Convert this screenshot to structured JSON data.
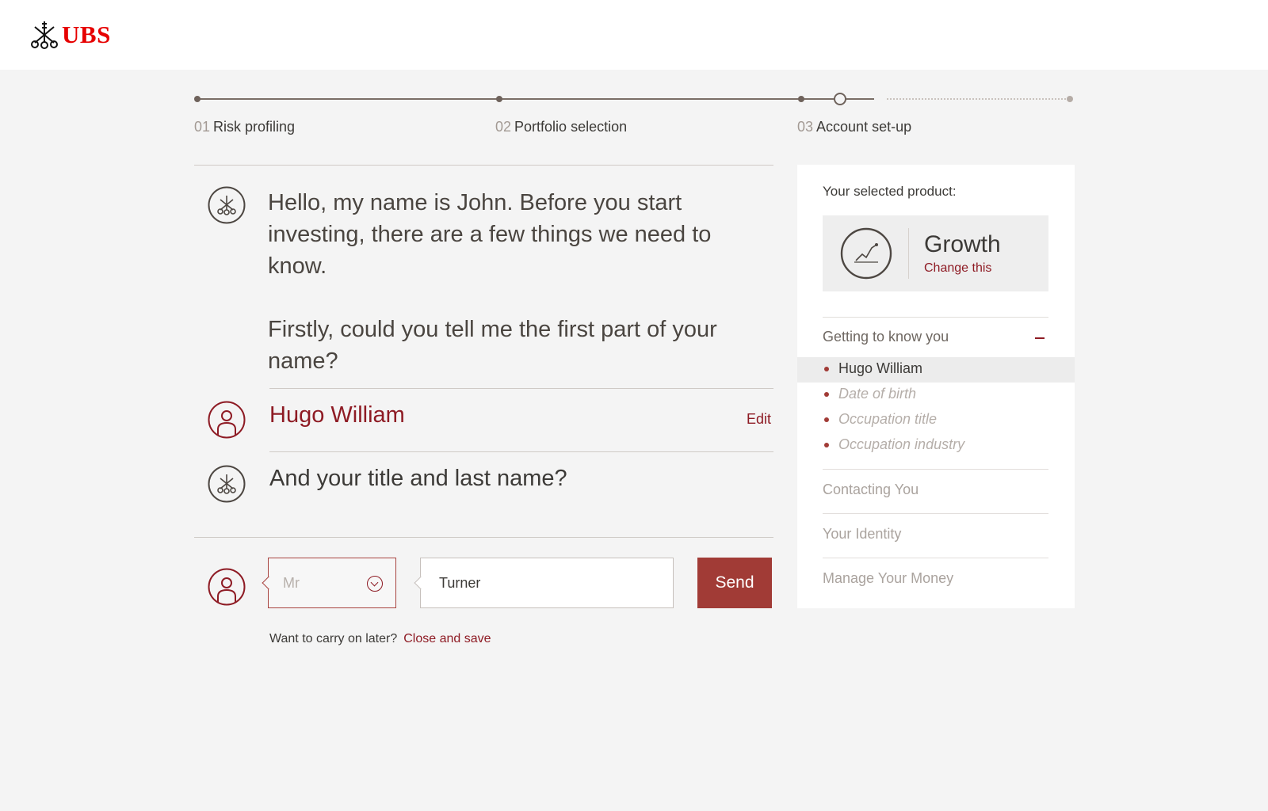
{
  "brand": {
    "name": "UBS",
    "color": "#e60000"
  },
  "steps": [
    {
      "num": "01",
      "label": "Risk profiling"
    },
    {
      "num": "02",
      "label": "Portfolio selection"
    },
    {
      "num": "03",
      "label": "Account set-up"
    }
  ],
  "conversation": {
    "bot_intro": "Hello, my name is John. Before you start investing, there are a few things we need to know.",
    "bot_question_first": "Firstly, could you tell me the first part of your name?",
    "user_answer": "Hugo William",
    "edit_label": "Edit",
    "bot_question_last": "And your title and last name?"
  },
  "form": {
    "title_select_value": "Mr",
    "lastname_value": "Turner",
    "send_label": "Send",
    "later_text": "Want to carry on later?",
    "close_save_label": "Close and save"
  },
  "panel": {
    "heading": "Your selected product:",
    "product_name": "Growth",
    "change_label": "Change this",
    "sections": [
      {
        "title": "Getting to know you",
        "expanded": true
      },
      {
        "title": "Contacting You"
      },
      {
        "title": "Your Identity"
      },
      {
        "title": "Manage Your Money"
      }
    ],
    "subitems": [
      "Hugo William",
      "Date of birth",
      "Occupation title",
      "Occupation industry"
    ]
  },
  "colors": {
    "accent": "#8e1b24",
    "button": "#a13b36",
    "background": "#f4f4f4"
  }
}
